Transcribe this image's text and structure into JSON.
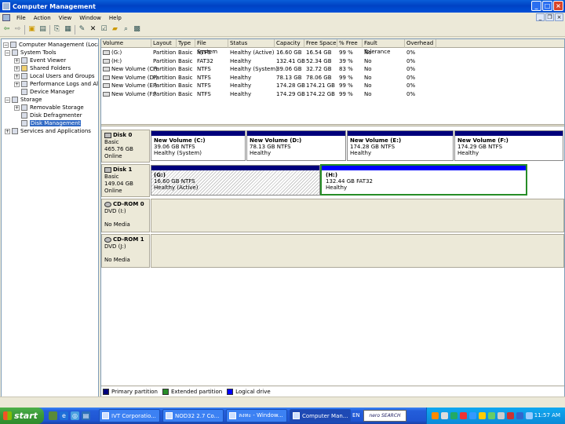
{
  "window": {
    "title": "Computer Management",
    "minimize": "_",
    "maximize": "□",
    "close": "×"
  },
  "menu": [
    "File",
    "Action",
    "View",
    "Window",
    "Help"
  ],
  "toolbar_icons": [
    "back-icon",
    "forward-icon",
    "up-icon",
    "show-hide-tree-icon",
    "properties-icon",
    "help-icon",
    "delete-icon",
    "properties2-icon",
    "open-icon",
    "search-icon",
    "refresh-icon"
  ],
  "tree": {
    "root": "Computer Management (Local)",
    "system_tools": "System Tools",
    "event_viewer": "Event Viewer",
    "shared_folders": "Shared Folders",
    "local_users": "Local Users and Groups",
    "perf_logs": "Performance Logs and Alerts",
    "device_manager": "Device Manager",
    "storage": "Storage",
    "removable": "Removable Storage",
    "defrag": "Disk Defragmenter",
    "disk_mgmt": "Disk Management",
    "services": "Services and Applications"
  },
  "volume_list": {
    "columns": [
      "Volume",
      "Layout",
      "Type",
      "File System",
      "Status",
      "Capacity",
      "Free Space",
      "% Free",
      "Fault Tolerance",
      "Overhead"
    ],
    "rows": [
      [
        "(G:)",
        "Partition",
        "Basic",
        "NTFS",
        "Healthy (Active)",
        "16.60 GB",
        "16.54 GB",
        "99 %",
        "No",
        "0%"
      ],
      [
        "(H:)",
        "Partition",
        "Basic",
        "FAT32",
        "Healthy",
        "132.41 GB",
        "52.34 GB",
        "39 %",
        "No",
        "0%"
      ],
      [
        "New Volume (C:)",
        "Partition",
        "Basic",
        "NTFS",
        "Healthy (System)",
        "39.06 GB",
        "32.72 GB",
        "83 %",
        "No",
        "0%"
      ],
      [
        "New Volume (D:)",
        "Partition",
        "Basic",
        "NTFS",
        "Healthy",
        "78.13 GB",
        "78.06 GB",
        "99 %",
        "No",
        "0%"
      ],
      [
        "New Volume (E:)",
        "Partition",
        "Basic",
        "NTFS",
        "Healthy",
        "174.28 GB",
        "174.21 GB",
        "99 %",
        "No",
        "0%"
      ],
      [
        "New Volume (F:)",
        "Partition",
        "Basic",
        "NTFS",
        "Healthy",
        "174.29 GB",
        "174.22 GB",
        "99 %",
        "No",
        "0%"
      ]
    ]
  },
  "disks": {
    "disk0": {
      "name": "Disk 0",
      "type": "Basic",
      "size": "465.76 GB",
      "status": "Online",
      "parts": [
        {
          "name": "New Volume  (C:)",
          "size": "39.06 GB NTFS",
          "status": "Healthy (System)"
        },
        {
          "name": "New Volume  (D:)",
          "size": "78.13 GB NTFS",
          "status": "Healthy"
        },
        {
          "name": "New Volume  (E:)",
          "size": "174.28 GB NTFS",
          "status": "Healthy"
        },
        {
          "name": "New Volume  (F:)",
          "size": "174.29 GB NTFS",
          "status": "Healthy"
        }
      ]
    },
    "disk1": {
      "name": "Disk 1",
      "type": "Basic",
      "size": "149.04 GB",
      "status": "Online",
      "parts": [
        {
          "name": "(G:)",
          "size": "16.60 GB NTFS",
          "status": "Healthy (Active)"
        },
        {
          "name": "(H:)",
          "size": "132.44 GB FAT32",
          "status": "Healthy"
        }
      ]
    },
    "cdrom0": {
      "name": "CD-ROM 0",
      "drive": "DVD (I:)",
      "media": "No Media"
    },
    "cdrom1": {
      "name": "CD-ROM 1",
      "drive": "DVD (J:)",
      "media": "No Media"
    }
  },
  "legend": [
    {
      "label": "Primary partition",
      "color": "#00007b"
    },
    {
      "label": "Extended partition",
      "color": "#278d27"
    },
    {
      "label": "Logical drive",
      "color": "#0000ff"
    }
  ],
  "taskbar": {
    "start": "start",
    "buttons": [
      "IVT Corporatio...",
      "NOD32 2.7 Co...",
      "ลงทะ - Window...",
      "Computer Man..."
    ],
    "lang": "EN",
    "nero": "nero SEARCH",
    "clock": "11:57 AM"
  }
}
